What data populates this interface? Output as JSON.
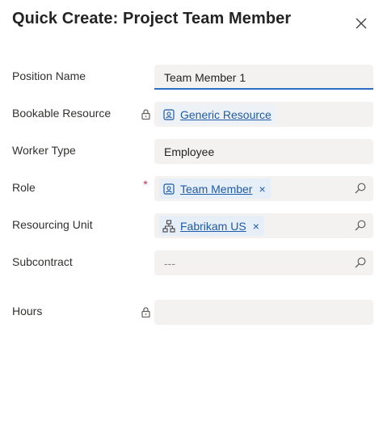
{
  "dialog": {
    "title": "Quick Create: Project Team Member",
    "close_icon": "close-icon"
  },
  "fields": {
    "position_name": {
      "label": "Position Name",
      "value": "Team Member 1"
    },
    "bookable_resource": {
      "label": "Bookable Resource",
      "value": "Generic Resource",
      "locked": true,
      "icon": "resource-icon"
    },
    "worker_type": {
      "label": "Worker Type",
      "value": "Employee"
    },
    "role": {
      "label": "Role",
      "required_marker": "*",
      "value": "Team Member",
      "remove": "×",
      "icon": "role-icon"
    },
    "resourcing_unit": {
      "label": "Resourcing Unit",
      "value": "Fabrikam US",
      "remove": "×",
      "icon": "org-unit-icon"
    },
    "subcontract": {
      "label": "Subcontract",
      "value": "---"
    },
    "hours": {
      "label": "Hours",
      "value": "",
      "locked": true
    }
  },
  "colors": {
    "accent": "#2e6dc4",
    "link": "#1f5ba6",
    "field_bg": "#f3f2f1",
    "required": "#c4314b"
  }
}
